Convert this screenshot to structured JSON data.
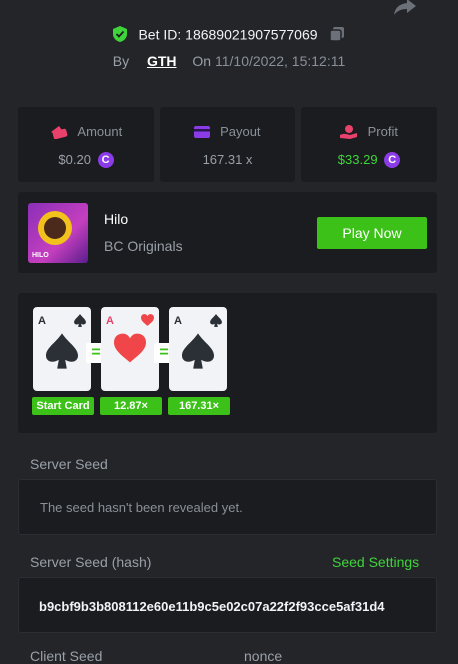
{
  "bet": {
    "label": "Bet ID:",
    "id": "186890219075770​69"
  },
  "byline": {
    "by": "By",
    "user": "GTH",
    "on": "On",
    "date": "11/10/2022, 15:12:11"
  },
  "stats": {
    "amount": {
      "label": "Amount",
      "value": "$0.20",
      "icon": "wallet-icon",
      "color": "#e8416b"
    },
    "payout": {
      "label": "Payout",
      "value": "167.31 x",
      "icon": "card-icon",
      "color": "#8b3ce8"
    },
    "profit": {
      "label": "Profit",
      "value": "$33.29",
      "icon": "hand-coin-icon",
      "color": "#e8416b"
    }
  },
  "coin_symbol": "C",
  "game": {
    "title": "Hilo",
    "provider": "BC Originals",
    "thumb_tag": "HILO",
    "play_label": "Play Now"
  },
  "cards": [
    {
      "rank": "A",
      "suit": "spade",
      "label": "Start Card"
    },
    {
      "rank": "A",
      "suit": "heart",
      "label": "12.87×"
    },
    {
      "rank": "A",
      "suit": "spade",
      "label": "167.31×"
    }
  ],
  "equals": "=",
  "server_seed": {
    "label": "Server Seed",
    "value": "The seed hasn't been revealed yet."
  },
  "server_seed_hash": {
    "label": "Server Seed (hash)",
    "settings": "Seed Settings",
    "value": "b9cbf9b3b808112e60e11b9c5e02c07a22f2f93cce5af31d4"
  },
  "client_seed": {
    "label": "Client Seed"
  },
  "nonce": {
    "label": "nonce"
  },
  "colors": {
    "accent": "#3bc117",
    "panel": "#1a1c1f",
    "background": "#232529"
  }
}
